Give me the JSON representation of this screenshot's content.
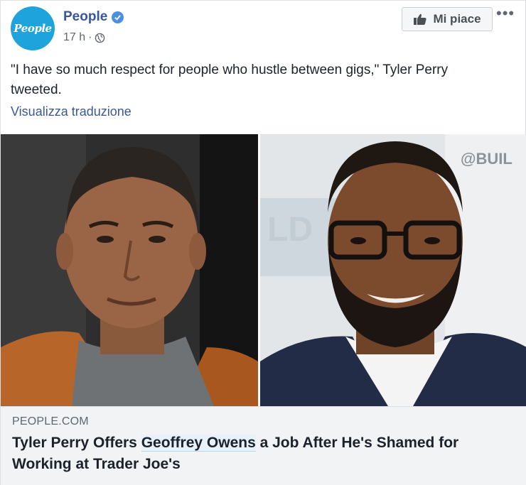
{
  "page": {
    "name": "People",
    "avatar_text": "People",
    "time": "17 h",
    "separator": "·",
    "like_label": "Mi piace",
    "more_label": "•••"
  },
  "post": {
    "text": "\"I have so much respect for people who hustle between gigs,\" Tyler Perry tweeted.",
    "see_translation": "Visualizza traduzione"
  },
  "images": {
    "right_watermark": "@BUIL",
    "right_bg_text": "LD"
  },
  "link": {
    "domain": "PEOPLE.COM",
    "headline_before": "Tyler Perry Offers ",
    "headline_highlight": "Geoffrey Owens",
    "headline_after": " a Job After He's Shamed for Working at Trader Joe's"
  },
  "colors": {
    "brand": "#1fa3dc",
    "link": "#385898",
    "name": "#365899"
  },
  "icons": {
    "verified": "verified-badge-icon",
    "globe": "globe-icon",
    "like": "thumbs-up-icon",
    "more": "more-options-icon"
  }
}
